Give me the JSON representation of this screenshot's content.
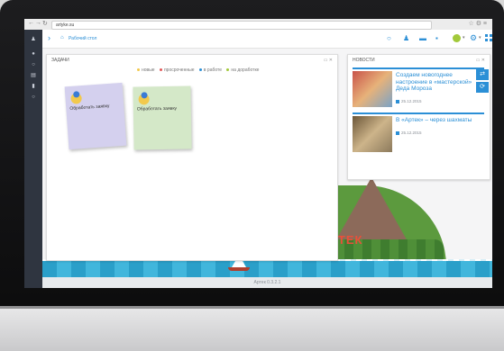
{
  "browser": {
    "back_glyph": "←",
    "forward_glyph": "→",
    "reload_glyph": "↻",
    "url": "artyke.su",
    "right_icons": "☆ ⚙ ≡"
  },
  "sidebar": {
    "icons": [
      "bell-icon",
      "circle-icon",
      "grid-icon",
      "doc-icon",
      "chart-icon",
      "settings-icon"
    ],
    "glyphs": [
      "♟",
      "●",
      "○",
      "▤",
      "▮",
      "○"
    ]
  },
  "header": {
    "chevron": "›",
    "home_glyph": "⌂",
    "title": "Рабочий стол",
    "icon_glyphs": [
      "○",
      "♟",
      "▬",
      "▪"
    ],
    "caret": "▾",
    "gear_glyph": "⚙"
  },
  "tasks": {
    "title": "Задачи",
    "controls": "▭ ✕",
    "filters": [
      {
        "label": "новые",
        "color": "#f2c94c"
      },
      {
        "label": "просроченные",
        "color": "#e15a5a"
      },
      {
        "label": "в работе",
        "color": "#2b8fd6"
      },
      {
        "label": "на доработке",
        "color": "#a2c93a"
      }
    ],
    "cards": [
      {
        "label": "Обработать заявку",
        "color": "#d4d0ee"
      },
      {
        "label": "Обработать заявку",
        "color": "#d4e8c8"
      }
    ]
  },
  "news": {
    "title": "Новости",
    "controls": "▭ ✕",
    "items": [
      {
        "title": "Создаем новогоднее настроение в «мастерской» Деда Мороза",
        "date": "25.12.2015"
      },
      {
        "title": "В «Артек» – через шахматы",
        "date": "25.12.2015"
      }
    ],
    "toggles": [
      "⇄",
      "⟳"
    ]
  },
  "brand": {
    "name": "АРТЕК"
  },
  "footer": {
    "version": "Артек 0.3.2.1"
  },
  "colors": {
    "accent": "#2b8fd6",
    "sidebar": "#2f3540"
  }
}
